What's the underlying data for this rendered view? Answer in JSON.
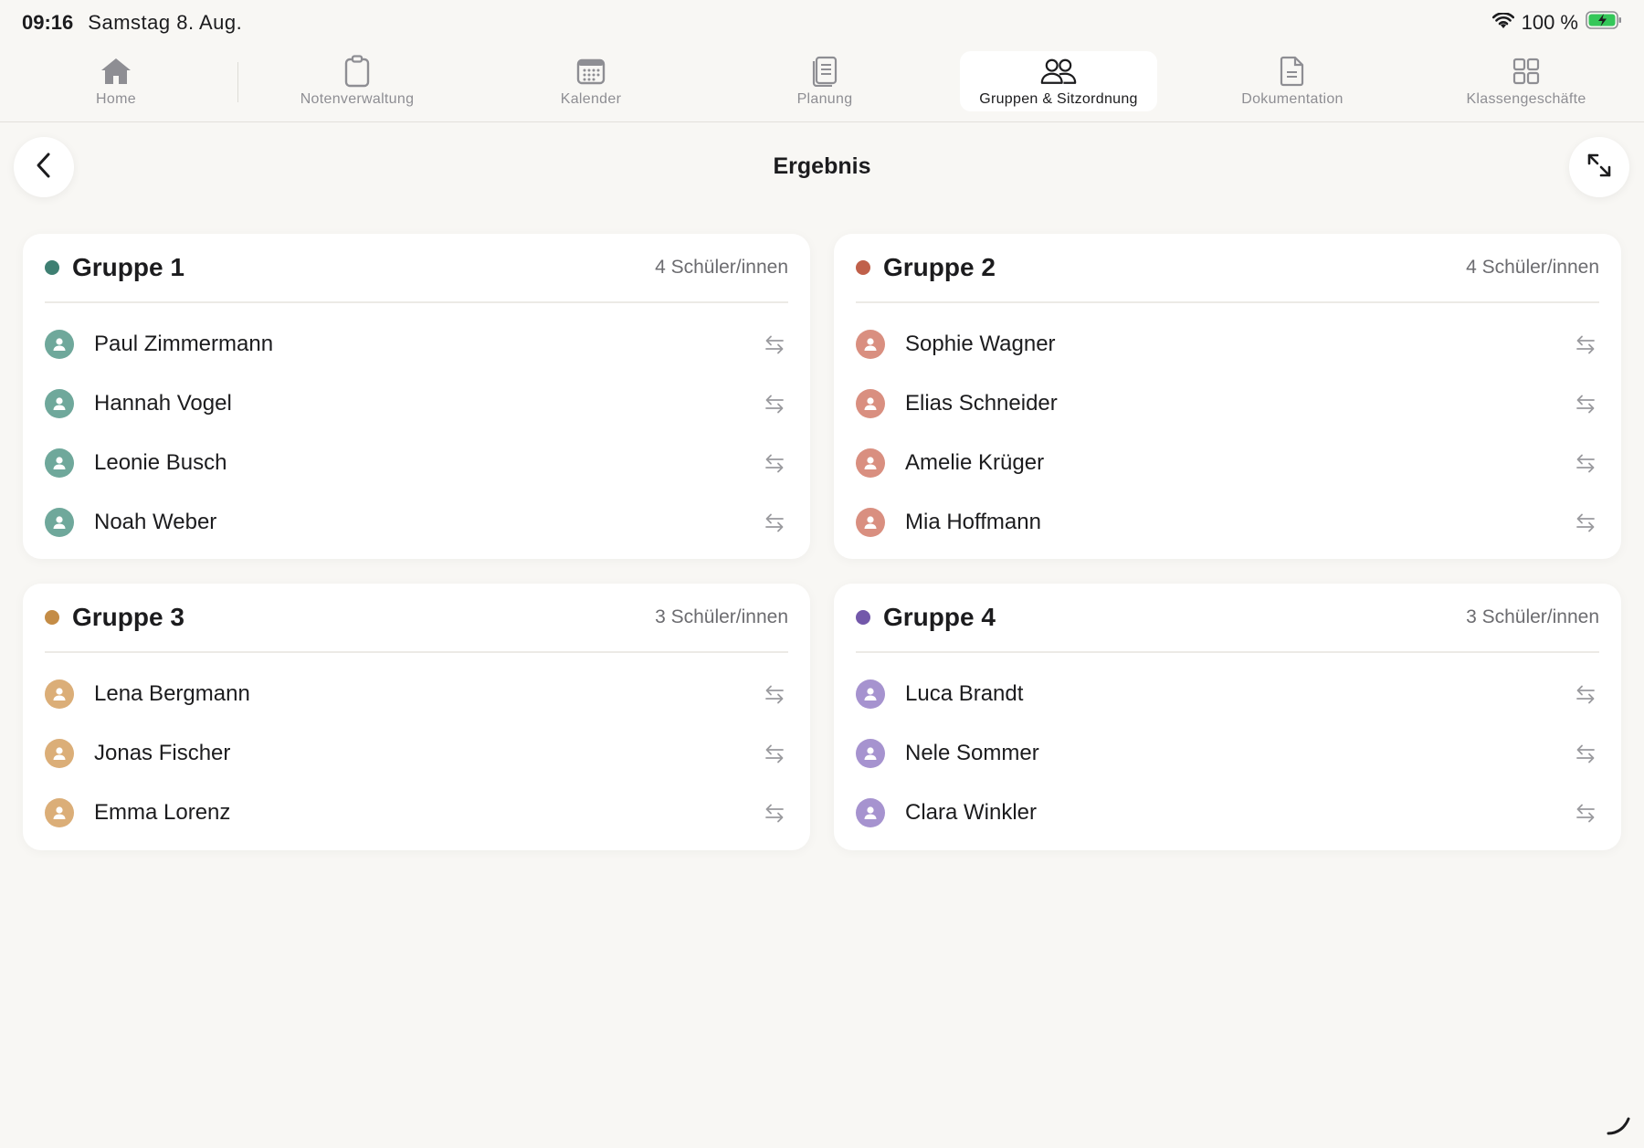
{
  "status": {
    "time": "09:16",
    "date": "Samstag 8. Aug.",
    "battery": "100 %"
  },
  "tabs": [
    {
      "label": "Home",
      "icon": "home-icon"
    },
    {
      "label": "Notenverwaltung",
      "icon": "clipboard-icon"
    },
    {
      "label": "Kalender",
      "icon": "calendar-icon"
    },
    {
      "label": "Planung",
      "icon": "document-stack-icon"
    },
    {
      "label": "Gruppen & Sitzordnung",
      "icon": "people-icon",
      "active": true
    },
    {
      "label": "Dokumentation",
      "icon": "document-icon"
    },
    {
      "label": "Klassengeschäfte",
      "icon": "grid-icon"
    }
  ],
  "header": {
    "title": "Ergebnis"
  },
  "colors": {
    "g1": "#3e7f72",
    "g1_avatar": "#6fa89b",
    "g2": "#c0604a",
    "g2_avatar": "#d98f80",
    "g3": "#c48c46",
    "g3_avatar": "#dbae78",
    "g4": "#7358aa",
    "g4_avatar": "#a693cf"
  },
  "groups": [
    {
      "name": "Gruppe 1",
      "count": "4 Schüler/innen",
      "members": [
        "Paul Zimmermann",
        "Hannah Vogel",
        "Leonie Busch",
        "Noah Weber"
      ]
    },
    {
      "name": "Gruppe 2",
      "count": "4 Schüler/innen",
      "members": [
        "Sophie Wagner",
        "Elias Schneider",
        "Amelie Krüger",
        "Mia Hoffmann"
      ]
    },
    {
      "name": "Gruppe 3",
      "count": "3 Schüler/innen",
      "members": [
        "Lena Bergmann",
        "Jonas Fischer",
        "Emma Lorenz"
      ]
    },
    {
      "name": "Gruppe 4",
      "count": "3 Schüler/innen",
      "members": [
        "Luca Brandt",
        "Nele Sommer",
        "Clara Winkler"
      ]
    }
  ]
}
